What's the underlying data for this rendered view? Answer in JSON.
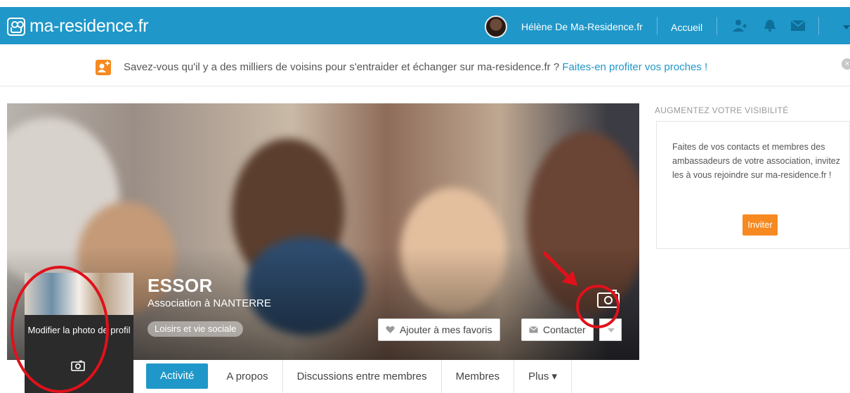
{
  "nav": {
    "logo_text": "ma-residence.fr",
    "user_name": "Hélène De Ma-Residence.fr",
    "home_label": "Accueil",
    "icons": [
      "contacts-icon",
      "bell-icon",
      "mail-icon",
      "chevron-down-icon"
    ],
    "brand_color": "#1f97c9"
  },
  "infobar": {
    "message": "Savez-vous qu'il y a des milliers de voisins pour s'entraider et échanger sur ma-residence.fr ? ",
    "link_text": "Faites-en profiter vos proches !",
    "close_label": "×"
  },
  "profile": {
    "org_name": "ESSOR",
    "subtitle": "Association à NANTERRE",
    "category": "Loisirs et vie sociale",
    "edit_photo_label": "Modifier la photo de profil"
  },
  "actions": {
    "favorite_label": "Ajouter à mes favoris",
    "contact_label": "Contacter"
  },
  "tabs": [
    {
      "label": "Activité",
      "active": true
    },
    {
      "label": "A propos",
      "active": false
    },
    {
      "label": "Discussions entre membres",
      "active": false
    },
    {
      "label": "Membres",
      "active": false
    },
    {
      "label": "Plus ▾",
      "active": false
    }
  ],
  "sidebar": {
    "title": "AUGMENTEZ VOTRE VISIBILITÉ",
    "text": "Faites de vos contacts et membres des ambassadeurs de votre association, invitez les à vous rejoindre sur ma-residence.fr !",
    "button_label": "Inviter",
    "button_color": "#f6891f"
  }
}
